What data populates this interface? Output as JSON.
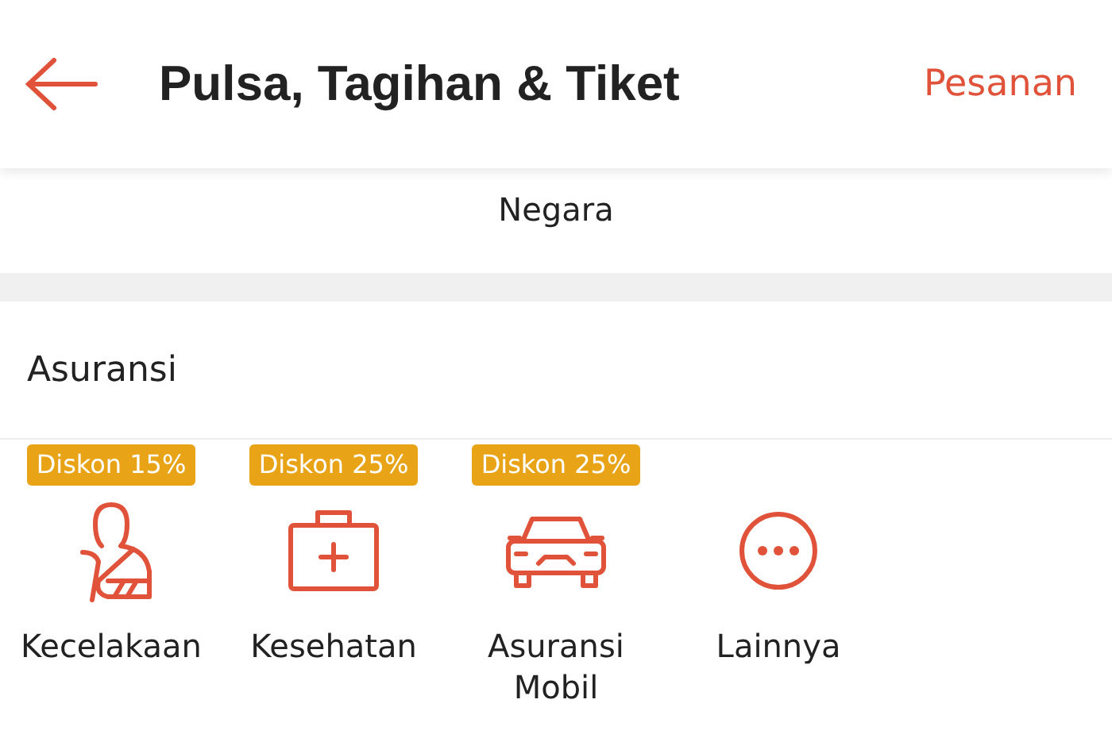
{
  "header": {
    "title": "Pulsa, Tagihan & Tiket",
    "action": "Pesanan"
  },
  "previous_section": {
    "items": [
      {
        "label": "Negara"
      }
    ]
  },
  "section": {
    "title": "Asuransi",
    "items": [
      {
        "kind": "accident",
        "label": "Kecelakaan",
        "badge": "Diskon 15%"
      },
      {
        "kind": "health",
        "label": "Kesehatan",
        "badge": "Diskon 25%"
      },
      {
        "kind": "car",
        "label": "Asuransi Mobil",
        "badge": "Diskon 25%"
      },
      {
        "kind": "more",
        "label": "Lainnya"
      }
    ]
  }
}
